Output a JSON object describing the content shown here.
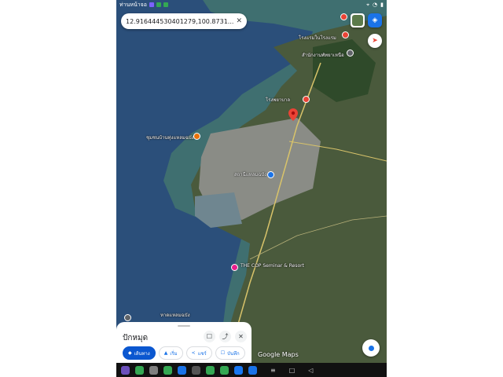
{
  "status": {
    "left_text": "ท่านหน้าจอ",
    "time": "",
    "icons": [
      "notification-icon",
      "sim-icon",
      "location-icon",
      "wifi-icon",
      "battery-icon"
    ]
  },
  "search": {
    "query": "12.916444530401279,100.8731...",
    "clear": "✕"
  },
  "map_labels": [
    {
      "id": "l1",
      "text": "โรงแรมในโรงแรม"
    },
    {
      "id": "l2",
      "text": "สำนักงานพัทยาเหนือ"
    },
    {
      "id": "l3",
      "text": "โรงพยาบาล"
    },
    {
      "id": "l4",
      "text": "ชุมชนบ้านทุ่งแหลมฉบัง"
    },
    {
      "id": "l5",
      "text": "สถานีแหลมฉบัง"
    },
    {
      "id": "l6",
      "text": "THE COP Seminar & Resort"
    },
    {
      "id": "l7",
      "text": "หาดแหลมฉบัง"
    }
  ],
  "place": {
    "title": "ปักหมุด"
  },
  "sheet_actions": {
    "bookmark": "☐",
    "share": "⤴",
    "close": "✕"
  },
  "chips": {
    "directions": "เส้นทาง",
    "start": "เริ่ม",
    "share": "แชร์",
    "save": "บันทึก"
  },
  "brand": "Google Maps",
  "colors": {
    "sea": "#2b4f7a",
    "shallow": "#3f6f70",
    "land": "#4a5a3c",
    "urban": "#8a8c86",
    "accent": "#0b57d0",
    "pin": "#ea4335"
  },
  "navbar": {
    "apps": [
      "#6b4fbb",
      "#34a853",
      "#7f7f7f",
      "#34a853",
      "#1a73e8",
      "#555555",
      "#34a853",
      "#34a853",
      "#1877f2",
      "#1a73e8"
    ],
    "menu": "≡",
    "home": "□",
    "back": "◁"
  }
}
